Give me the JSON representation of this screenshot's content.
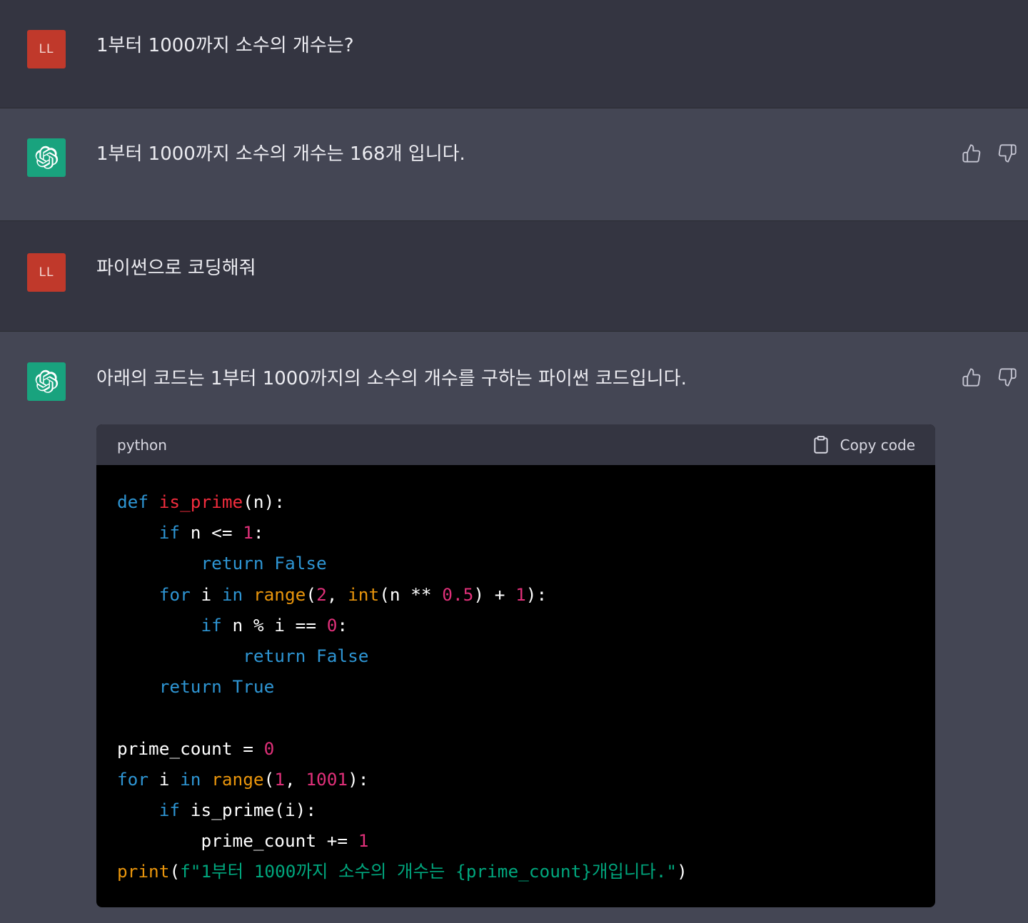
{
  "conversation": [
    {
      "role": "user",
      "avatar": "LL",
      "text": "1부터 1000까지 소수의 개수는?"
    },
    {
      "role": "assistant",
      "text": "1부터 1000까지 소수의 개수는 168개 입니다."
    },
    {
      "role": "user",
      "avatar": "LL",
      "text": "파이썬으로 코딩해줘"
    },
    {
      "role": "assistant",
      "text": "아래의 코드는 1부터 1000까지의 소수의 개수를 구하는 파이썬 코드입니다."
    }
  ],
  "code_block": {
    "language": "python",
    "copy_label": "Copy code",
    "lines": [
      [
        {
          "t": "def",
          "c": "kw"
        },
        {
          "t": " "
        },
        {
          "t": "is_prime",
          "c": "fn"
        },
        {
          "t": "(n):"
        }
      ],
      [
        {
          "t": "    "
        },
        {
          "t": "if",
          "c": "kw"
        },
        {
          "t": " n <= "
        },
        {
          "t": "1",
          "c": "num"
        },
        {
          "t": ":"
        }
      ],
      [
        {
          "t": "        "
        },
        {
          "t": "return",
          "c": "kw"
        },
        {
          "t": " "
        },
        {
          "t": "False",
          "c": "kw"
        }
      ],
      [
        {
          "t": "    "
        },
        {
          "t": "for",
          "c": "kw"
        },
        {
          "t": " i "
        },
        {
          "t": "in",
          "c": "kw"
        },
        {
          "t": " "
        },
        {
          "t": "range",
          "c": "bi"
        },
        {
          "t": "("
        },
        {
          "t": "2",
          "c": "num"
        },
        {
          "t": ", "
        },
        {
          "t": "int",
          "c": "bi"
        },
        {
          "t": "(n ** "
        },
        {
          "t": "0.5",
          "c": "num"
        },
        {
          "t": ") + "
        },
        {
          "t": "1",
          "c": "num"
        },
        {
          "t": "):"
        }
      ],
      [
        {
          "t": "        "
        },
        {
          "t": "if",
          "c": "kw"
        },
        {
          "t": " n % i == "
        },
        {
          "t": "0",
          "c": "num"
        },
        {
          "t": ":"
        }
      ],
      [
        {
          "t": "            "
        },
        {
          "t": "return",
          "c": "kw"
        },
        {
          "t": " "
        },
        {
          "t": "False",
          "c": "kw"
        }
      ],
      [
        {
          "t": "    "
        },
        {
          "t": "return",
          "c": "kw"
        },
        {
          "t": " "
        },
        {
          "t": "True",
          "c": "kw"
        }
      ],
      [],
      [
        {
          "t": "prime_count = "
        },
        {
          "t": "0",
          "c": "num"
        }
      ],
      [
        {
          "t": "for",
          "c": "kw"
        },
        {
          "t": " i "
        },
        {
          "t": "in",
          "c": "kw"
        },
        {
          "t": " "
        },
        {
          "t": "range",
          "c": "bi"
        },
        {
          "t": "("
        },
        {
          "t": "1",
          "c": "num"
        },
        {
          "t": ", "
        },
        {
          "t": "1001",
          "c": "num"
        },
        {
          "t": "):"
        }
      ],
      [
        {
          "t": "    "
        },
        {
          "t": "if",
          "c": "kw"
        },
        {
          "t": " is_prime(i):"
        }
      ],
      [
        {
          "t": "        prime_count += "
        },
        {
          "t": "1",
          "c": "num"
        }
      ],
      [
        {
          "t": "print",
          "c": "bi"
        },
        {
          "t": "("
        },
        {
          "t": "f\"1부터 1000까지 소수의 개수는 {prime_count}개입니다.\"",
          "c": "str"
        },
        {
          "t": ")"
        }
      ]
    ]
  },
  "icons": {
    "thumbs_up": "thumbs-up-icon",
    "thumbs_down": "thumbs-down-icon",
    "clipboard": "clipboard-icon",
    "assistant_logo": "openai-logo-icon"
  },
  "colors": {
    "user_bg": "#343541",
    "assistant_bg": "#444654",
    "user_avatar": "#c0392b",
    "assistant_avatar": "#19a37e",
    "keyword": "#2e95d3",
    "function": "#f22c3d",
    "builtin": "#e9950c",
    "number": "#df3079",
    "string": "#00a67d"
  }
}
